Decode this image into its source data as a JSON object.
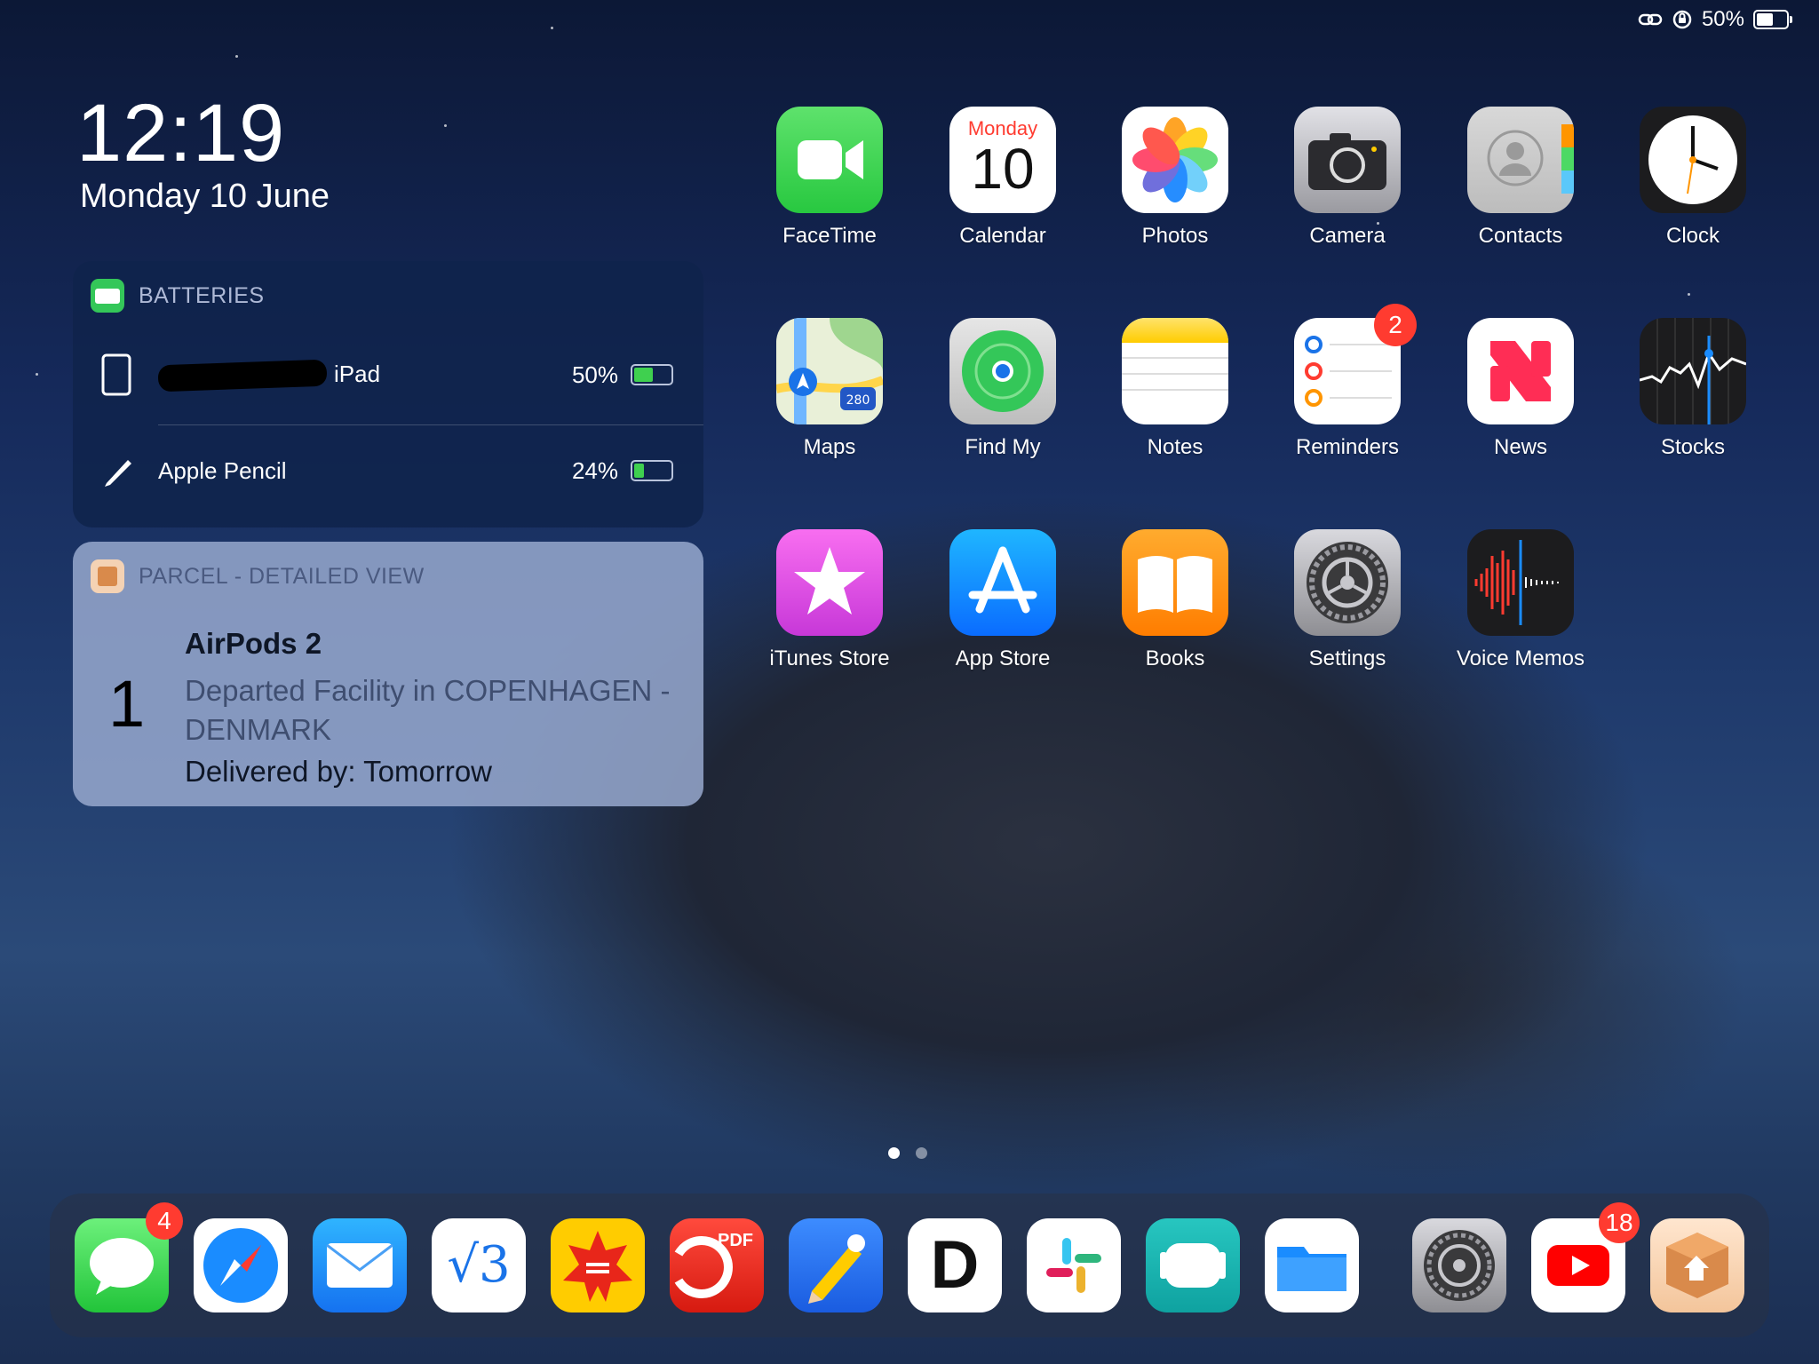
{
  "status_bar": {
    "battery": "50%"
  },
  "lock": {
    "time": "12:19",
    "date": "Monday 10 June"
  },
  "batteries_widget": {
    "title": "BATTERIES",
    "devices": [
      {
        "name": "iPad",
        "percent": "50%",
        "level": 0.5
      },
      {
        "name": "Apple Pencil",
        "percent": "24%",
        "level": 0.24
      }
    ]
  },
  "parcel_widget": {
    "title": "PARCEL - DETAILED VIEW",
    "count": "1",
    "item": "AirPods 2",
    "status": "Departed Facility in COPENHAGEN - DENMARK",
    "delivery": "Delivered by: Tomorrow"
  },
  "calendar_icon": {
    "day": "Monday",
    "date": "10"
  },
  "apps": [
    {
      "label": "FaceTime"
    },
    {
      "label": "Calendar"
    },
    {
      "label": "Photos"
    },
    {
      "label": "Camera"
    },
    {
      "label": "Contacts"
    },
    {
      "label": "Clock"
    },
    {
      "label": "Maps"
    },
    {
      "label": "Find My"
    },
    {
      "label": "Notes"
    },
    {
      "label": "Reminders",
      "badge": "2"
    },
    {
      "label": "News"
    },
    {
      "label": "Stocks"
    },
    {
      "label": "iTunes Store"
    },
    {
      "label": "App Store"
    },
    {
      "label": "Books"
    },
    {
      "label": "Settings"
    },
    {
      "label": "Voice Memos"
    }
  ],
  "maps_icon": {
    "shield": "280"
  },
  "dock": {
    "messages_badge": "4",
    "v3_text": "√3",
    "pdf_text": "PDF",
    "d_text": "D",
    "youtube_badge": "18"
  },
  "colors": {
    "badge": "#ff3b30",
    "battery_green": "#3fd04f",
    "facetime": "#34c759",
    "appstore": "#1a8cff",
    "books": "#ff9500",
    "voicememo": "#1c1c1e"
  }
}
